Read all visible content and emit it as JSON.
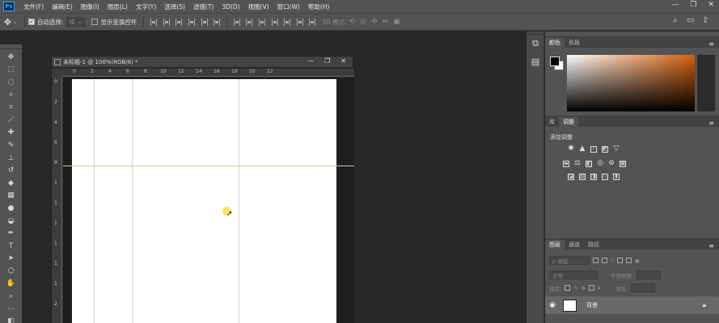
{
  "app": {
    "logo": "Ps"
  },
  "menu": [
    "文件(F)",
    "编辑(E)",
    "图像(I)",
    "图层(L)",
    "文字(Y)",
    "选择(S)",
    "滤镜(T)",
    "3D(D)",
    "视图(V)",
    "窗口(W)",
    "帮助(H)"
  ],
  "window_controls": {
    "minimize": "—",
    "restore": "❐",
    "close": "✕"
  },
  "options": {
    "auto_select_label": "自动选择:",
    "auto_select_value": "组",
    "show_transform_label": "显示变换控件",
    "mode_3d_label": "3D 模式:"
  },
  "document": {
    "title": "未标题-1 @ 100%(RGB/8) *",
    "ruler_h": [
      "0",
      "2",
      "4",
      "6",
      "8",
      "10",
      "12",
      "14",
      "16",
      "18",
      "20",
      "22"
    ],
    "ruler_v": [
      "0",
      "2",
      "4",
      "6",
      "8",
      "1",
      "1",
      "1",
      "1",
      "1",
      "1",
      "2"
    ]
  },
  "panels": {
    "color_tabs": [
      "颜色",
      "色板"
    ],
    "adjust_tabs": [
      "库",
      "调整"
    ],
    "adjust_title": "添加调整",
    "layers_tabs": [
      "图层",
      "通道",
      "路径"
    ],
    "kind_placeholder": "ρ 类型",
    "blend_mode": "正常",
    "opacity_label": "不透明度:",
    "lock_label": "锁定:",
    "fill_label": "填充:",
    "layer_name": "背景"
  }
}
